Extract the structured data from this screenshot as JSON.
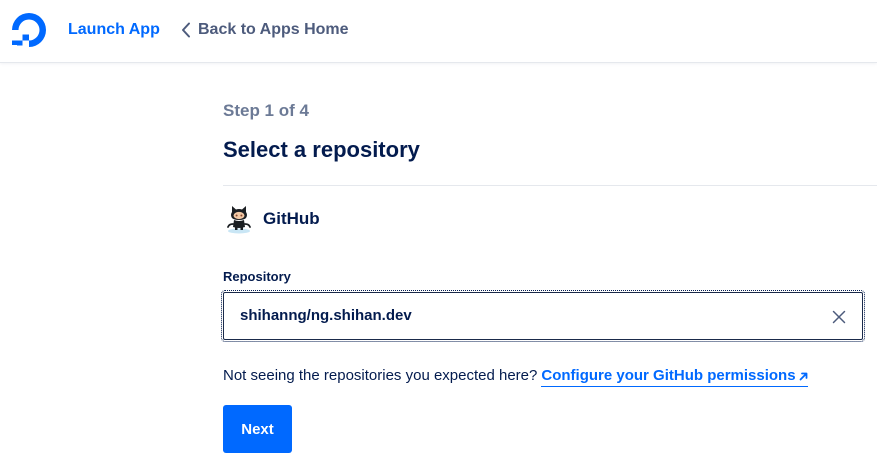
{
  "header": {
    "app_link": "Launch App",
    "back_link": "Back to Apps Home"
  },
  "wizard": {
    "step": "Step 1 of 4",
    "title": "Select a repository",
    "provider": "GitHub",
    "repository_label": "Repository",
    "repository_value": "shihanng/ng.shihan.dev",
    "help_text": "Not seeing the repositories you expected here?",
    "help_link": "Configure your GitHub permissions",
    "next_label": "Next"
  },
  "icons": {
    "logo": "digitalocean-logo",
    "back": "chevron-left-icon",
    "provider": "github-octocat-icon",
    "clear": "close-icon",
    "external": "arrow-up-right-icon"
  },
  "colors": {
    "accent": "#0069ff",
    "text": "#031b4e",
    "muted": "#6c7a96"
  }
}
